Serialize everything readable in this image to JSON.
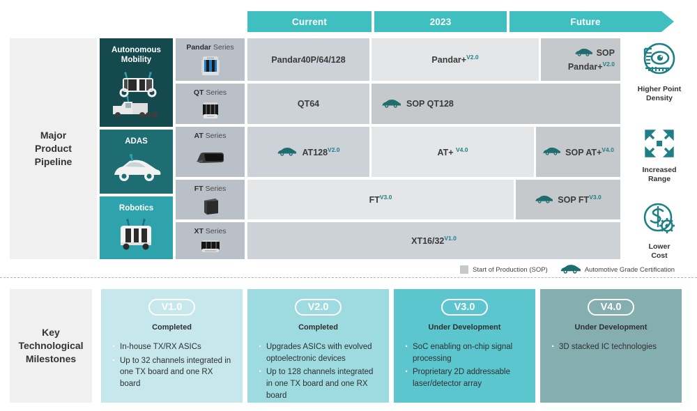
{
  "colors": {
    "teal_header": "#40bfc1",
    "teal_dark": "#14494e",
    "teal_mid": "#1d6d72",
    "teal_light": "#2fa3ac",
    "icon_teal": "#1f7f86",
    "cell_light": "#e4e6e8",
    "cell_mid": "#ccd2d8",
    "cell_sop": "#c6c9cb",
    "series_bg": "#b9c0c8",
    "panel_bg": "#f0f0f0",
    "v1_bg": "#c6e7ec",
    "v2_bg": "#9ddbe0",
    "v3_bg": "#5cc6cf",
    "v4_bg": "#85aeb1"
  },
  "timeline": {
    "headers": [
      {
        "label": "Current",
        "arrow": false
      },
      {
        "label": "2023",
        "arrow": false
      },
      {
        "label": "Future",
        "arrow": true
      }
    ]
  },
  "pipeline": {
    "section_title": "Major\nProduct\nPipeline",
    "section_title_lines": [
      "Major",
      "Product",
      "Pipeline"
    ],
    "segments": [
      {
        "label_lines": [
          "Autonomous",
          "Mobility"
        ],
        "icon": "shuttle-and-truck-icon"
      },
      {
        "label_lines": [
          "ADAS"
        ],
        "icon": "car-icon"
      },
      {
        "label_lines": [
          "Robotics"
        ],
        "icon": "robot-delivery-vehicle-icon"
      }
    ],
    "series": [
      {
        "name": "Pandar",
        "suffix": " Series",
        "icon": "pandar-lidar-icon"
      },
      {
        "name": "QT",
        "suffix": " Series",
        "icon": "qt-lidar-icon"
      },
      {
        "name": "AT",
        "suffix": " Series",
        "icon": "at-lidar-icon"
      },
      {
        "name": "FT",
        "suffix": " Series",
        "icon": "ft-lidar-icon"
      },
      {
        "name": "XT",
        "suffix": " Series",
        "icon": "xt-lidar-icon"
      }
    ],
    "cells": {
      "pandar_current": {
        "text": "Pandar40P/64/128",
        "version": ""
      },
      "pandar_2023": {
        "text": "Pandar+",
        "version": "V2.0"
      },
      "pandar_future_l1": {
        "text": "SOP",
        "version": ""
      },
      "pandar_future_l2": {
        "text": "Pandar+",
        "version": "V2.0"
      },
      "qt_current": {
        "text": "QT64",
        "version": ""
      },
      "qt_sop": {
        "text": "SOP QT128",
        "version": ""
      },
      "at_current": {
        "text": "AT128",
        "version": "V2.0"
      },
      "at_2023": {
        "text": "AT+ ",
        "version": "V4.0"
      },
      "at_future": {
        "text": "SOP AT+",
        "version": "V4.0"
      },
      "ft_main": {
        "text": "FT",
        "version": "V3.0"
      },
      "ft_future": {
        "text": "SOP FT",
        "version": "V3.0"
      },
      "xt_main": {
        "text": "XT16/32",
        "version": "V1.0"
      }
    },
    "benefits": [
      {
        "label_lines": [
          "Higher Point",
          "Density"
        ],
        "icon": "eye-scan-icon"
      },
      {
        "label_lines": [
          "Increased",
          "Range"
        ],
        "icon": "four-arrows-expand-icon"
      },
      {
        "label_lines": [
          "Lower",
          "Cost"
        ],
        "icon": "dollar-gear-icon"
      }
    ],
    "legend": [
      {
        "type": "swatch",
        "label": "Start of Production (SOP)",
        "icon": "gray-square-icon"
      },
      {
        "type": "car",
        "label": "Automotive Grade Certification",
        "icon": "car-icon"
      }
    ]
  },
  "milestones": {
    "section_title_lines": [
      "Key",
      "Technological",
      "Milestones"
    ],
    "cards": [
      {
        "version": "V1.0",
        "status": "Completed",
        "bg": "#c6e7ec",
        "bullets": [
          "In-house TX/RX ASICs",
          "Up to 32 channels integrated in one TX board and one RX board"
        ]
      },
      {
        "version": "V2.0",
        "status": "Completed",
        "bg": "#9ddbe0",
        "bullets": [
          "Upgrades ASICs with evolved optoelectronic devices",
          "Up to 128 channels integrated in one TX board and one RX board"
        ]
      },
      {
        "version": "V3.0",
        "status": "Under Development",
        "bg": "#5cc6cf",
        "bullets": [
          "SoC enabling on-chip signal processing",
          "Proprietary 2D addressable laser/detector array"
        ]
      },
      {
        "version": "V4.0",
        "status": "Under Development",
        "bg": "#85aeb1",
        "bullets": [
          "3D stacked IC technologies"
        ]
      }
    ]
  }
}
